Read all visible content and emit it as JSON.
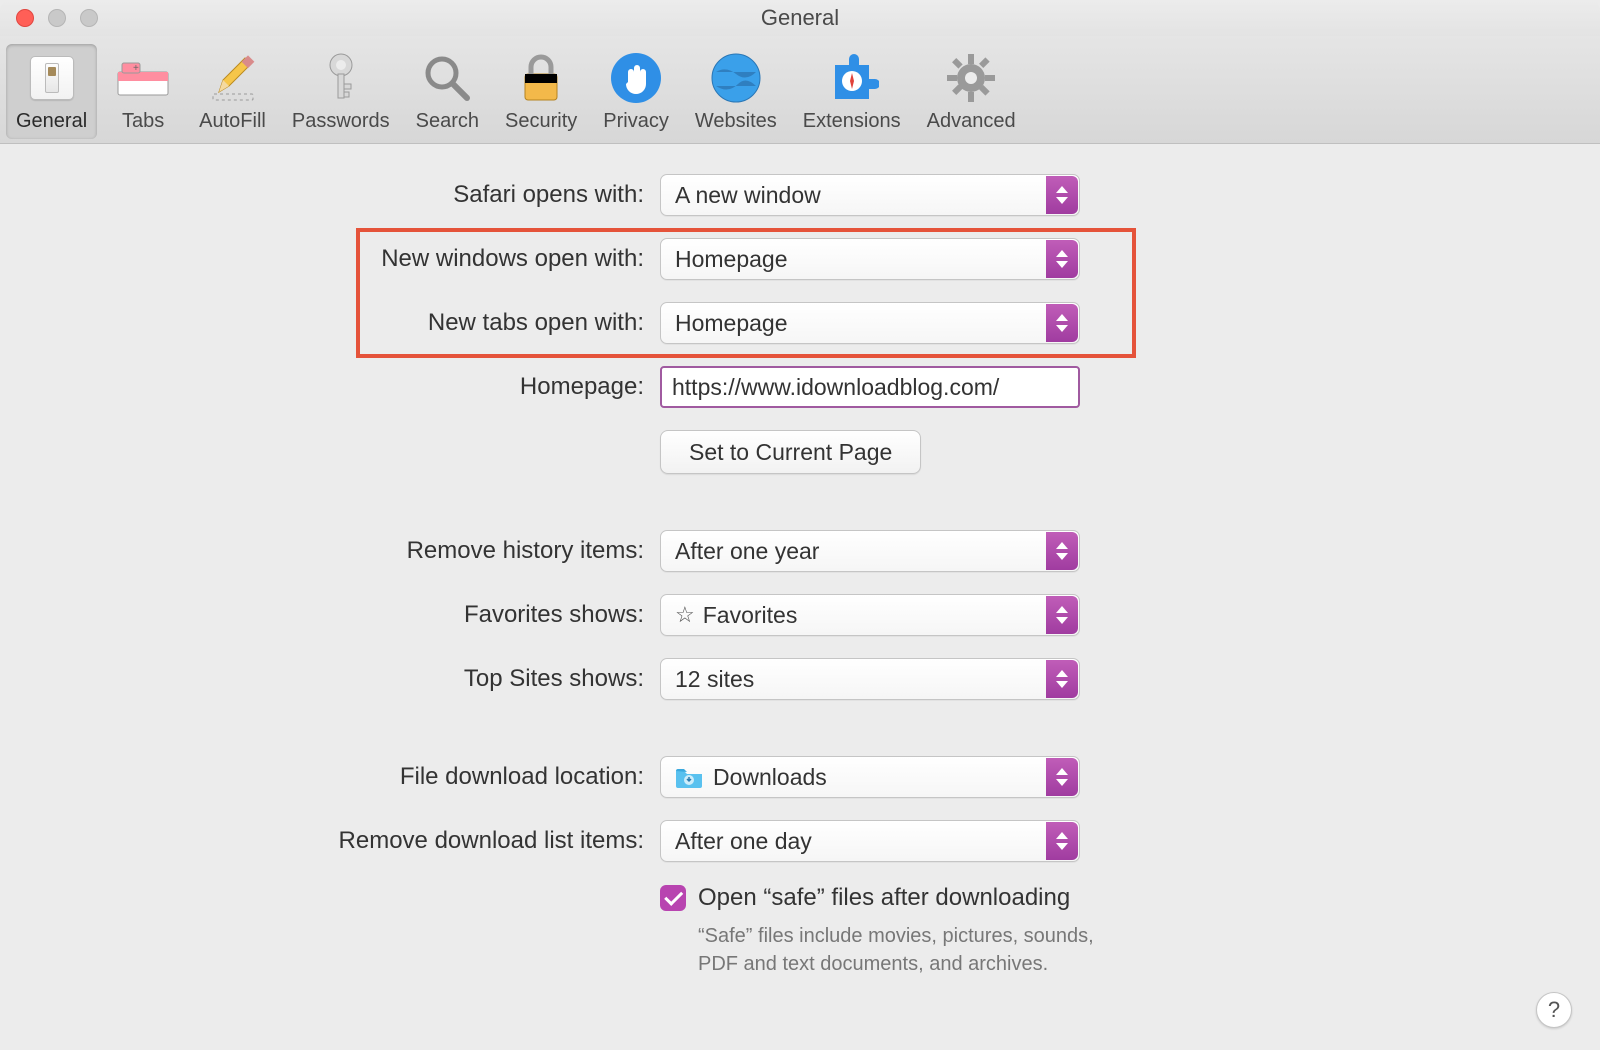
{
  "window": {
    "title": "General"
  },
  "toolbar": {
    "items": [
      {
        "label": "General",
        "name": "general-tab",
        "selected": true
      },
      {
        "label": "Tabs",
        "name": "tabs-tab"
      },
      {
        "label": "AutoFill",
        "name": "autofill-tab"
      },
      {
        "label": "Passwords",
        "name": "passwords-tab"
      },
      {
        "label": "Search",
        "name": "search-tab"
      },
      {
        "label": "Security",
        "name": "security-tab"
      },
      {
        "label": "Privacy",
        "name": "privacy-tab"
      },
      {
        "label": "Websites",
        "name": "websites-tab"
      },
      {
        "label": "Extensions",
        "name": "extensions-tab"
      },
      {
        "label": "Advanced",
        "name": "advanced-tab"
      }
    ]
  },
  "form": {
    "safari_opens_with": {
      "label": "Safari opens with:",
      "value": "A new window"
    },
    "new_windows_open_with": {
      "label": "New windows open with:",
      "value": "Homepage"
    },
    "new_tabs_open_with": {
      "label": "New tabs open with:",
      "value": "Homepage"
    },
    "homepage": {
      "label": "Homepage:",
      "value": "https://www.idownloadblog.com/"
    },
    "set_current_page": {
      "label": "Set to Current Page"
    },
    "remove_history_items": {
      "label": "Remove history items:",
      "value": "After one year"
    },
    "favorites_shows": {
      "label": "Favorites shows:",
      "value": "Favorites"
    },
    "top_sites_shows": {
      "label": "Top Sites shows:",
      "value": "12 sites"
    },
    "file_download_location": {
      "label": "File download location:",
      "value": "Downloads"
    },
    "remove_download_list": {
      "label": "Remove download list items:",
      "value": "After one day"
    },
    "open_safe_files": {
      "label": "Open “safe” files after downloading",
      "checked": true
    },
    "safe_note": "“Safe” files include movies, pictures, sounds, PDF and text documents, and archives."
  },
  "annotations": {
    "red_box": true,
    "purple_box": true
  },
  "colors": {
    "accent": "#b844b0",
    "red_highlight": "#e5533a",
    "purple_highlight": "#a05aa0"
  }
}
